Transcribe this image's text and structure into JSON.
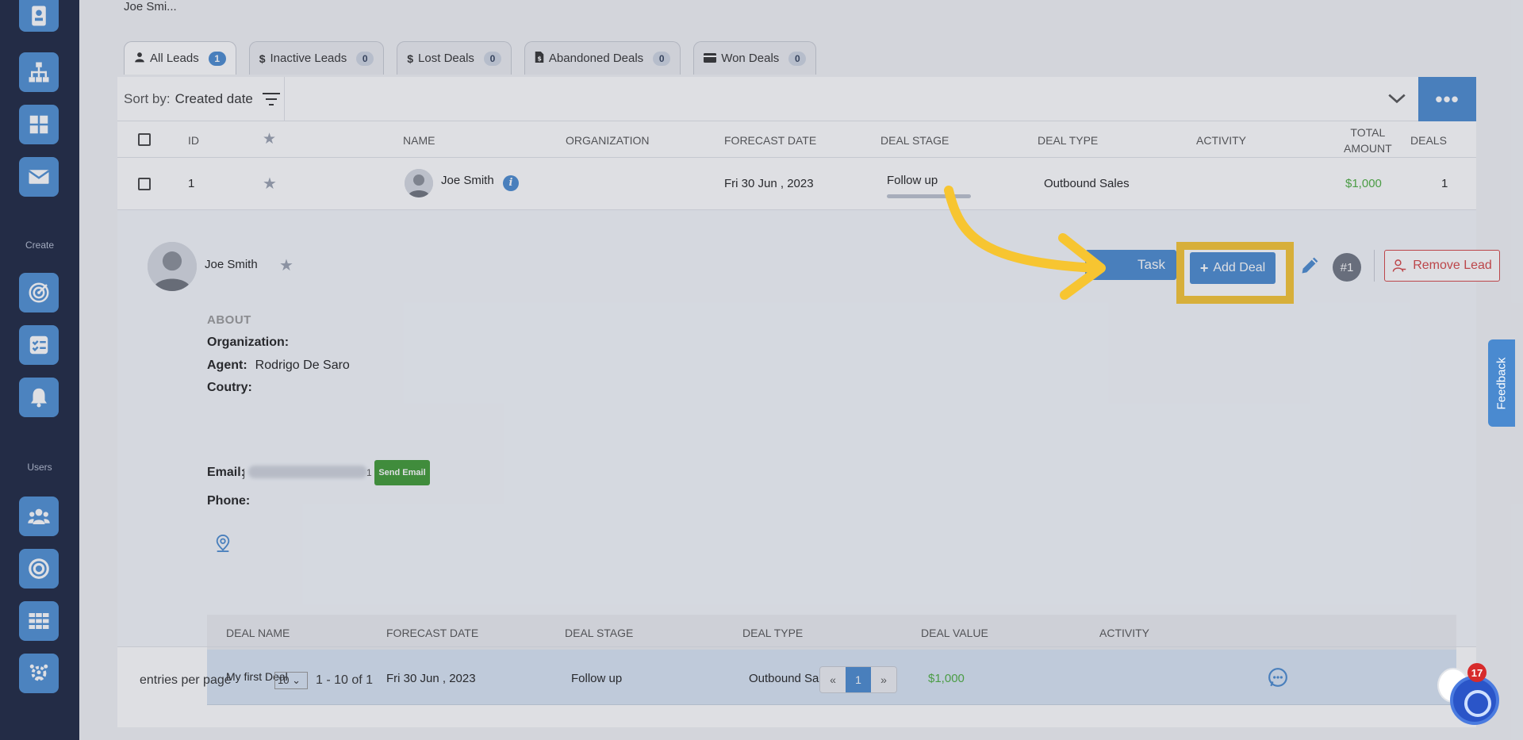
{
  "sidebar": {
    "create_label": "Create",
    "users_label": "Users"
  },
  "breadcrumb": "Joe Smi...",
  "tabs": [
    {
      "label": "All Leads",
      "count": "1"
    },
    {
      "label": "Inactive Leads",
      "count": "0"
    },
    {
      "label": "Lost Deals",
      "count": "0"
    },
    {
      "label": "Abandoned Deals",
      "count": "0"
    },
    {
      "label": "Won Deals",
      "count": "0"
    }
  ],
  "sort": {
    "label": "Sort by:",
    "value": "Created date"
  },
  "more_label": "•••",
  "table": {
    "headers": {
      "id": "ID",
      "name": "NAME",
      "organization": "ORGANIZATION",
      "forecast_date": "FORECAST DATE",
      "deal_stage": "DEAL STAGE",
      "deal_type": "DEAL TYPE",
      "activity": "ACTIVITY",
      "total_amount_1": "TOTAL",
      "total_amount_2": "AMOUNT",
      "deals": "DEALS"
    },
    "row": {
      "id": "1",
      "name": "Joe Smith",
      "forecast_date": "Fri 30 Jun , 2023",
      "deal_stage": "Follow up",
      "deal_type": "Outbound Sales",
      "total_amount": "$1,000",
      "deals": "1"
    }
  },
  "detail": {
    "name": "Joe Smith",
    "about": "ABOUT",
    "organization_label": "Organization:",
    "agent_label": "Agent:",
    "agent_value": "Rodrigo De Saro",
    "country_label": "Coutry:",
    "email_label": "Email:",
    "email_prefix": "j",
    "email_suffix": "1",
    "send_email": "Send Email",
    "phone_label": "Phone:",
    "task_label": "Task",
    "add_deal_label": "Add Deal",
    "number_badge": "#1",
    "remove_lead": "Remove Lead"
  },
  "deals": {
    "headers": {
      "name": "DEAL NAME",
      "forecast_date": "FORECAST DATE",
      "stage": "DEAL STAGE",
      "type": "DEAL TYPE",
      "value": "DEAL VALUE",
      "activity": "ACTIVITY"
    },
    "row": {
      "name": "My first Deal",
      "forecast_date": "Fri 30 Jun , 2023",
      "stage": "Follow up",
      "type": "Outbound Sales",
      "value": "$1,000"
    }
  },
  "pagination": {
    "entries_label": "entries per page",
    "per_page": "10",
    "range": "1 - 10 of 1",
    "prev": "«",
    "current": "1",
    "next": "»"
  },
  "feedback_label": "Feedback",
  "chat_notifications": "17",
  "colors": {
    "highlight": "#f7c531",
    "accent": "#4a8ad0",
    "sidebar": "#1b2540",
    "amount_green": "#4cae3f",
    "danger": "#d64545"
  }
}
